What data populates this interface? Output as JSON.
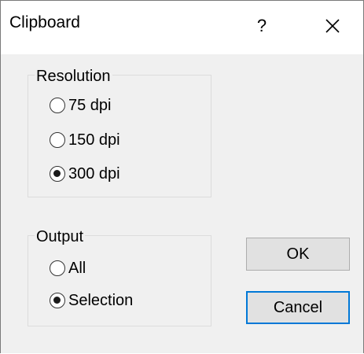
{
  "window": {
    "title": "Clipboard",
    "help_glyph": "?",
    "close_icon": "close-icon"
  },
  "resolution": {
    "label": "Resolution",
    "options": [
      {
        "label": "75 dpi",
        "checked": false
      },
      {
        "label": "150 dpi",
        "checked": false
      },
      {
        "label": "300 dpi",
        "checked": true
      }
    ]
  },
  "output": {
    "label": "Output",
    "options": [
      {
        "label": "All",
        "checked": false
      },
      {
        "label": "Selection",
        "checked": true
      }
    ]
  },
  "buttons": {
    "ok_label": "OK",
    "cancel_label": "Cancel"
  },
  "colors": {
    "dialog_background": "#f0f0f0",
    "titlebar_background": "#ffffff",
    "default_button_border": "#0078d7",
    "button_face": "#e1e1e1"
  }
}
